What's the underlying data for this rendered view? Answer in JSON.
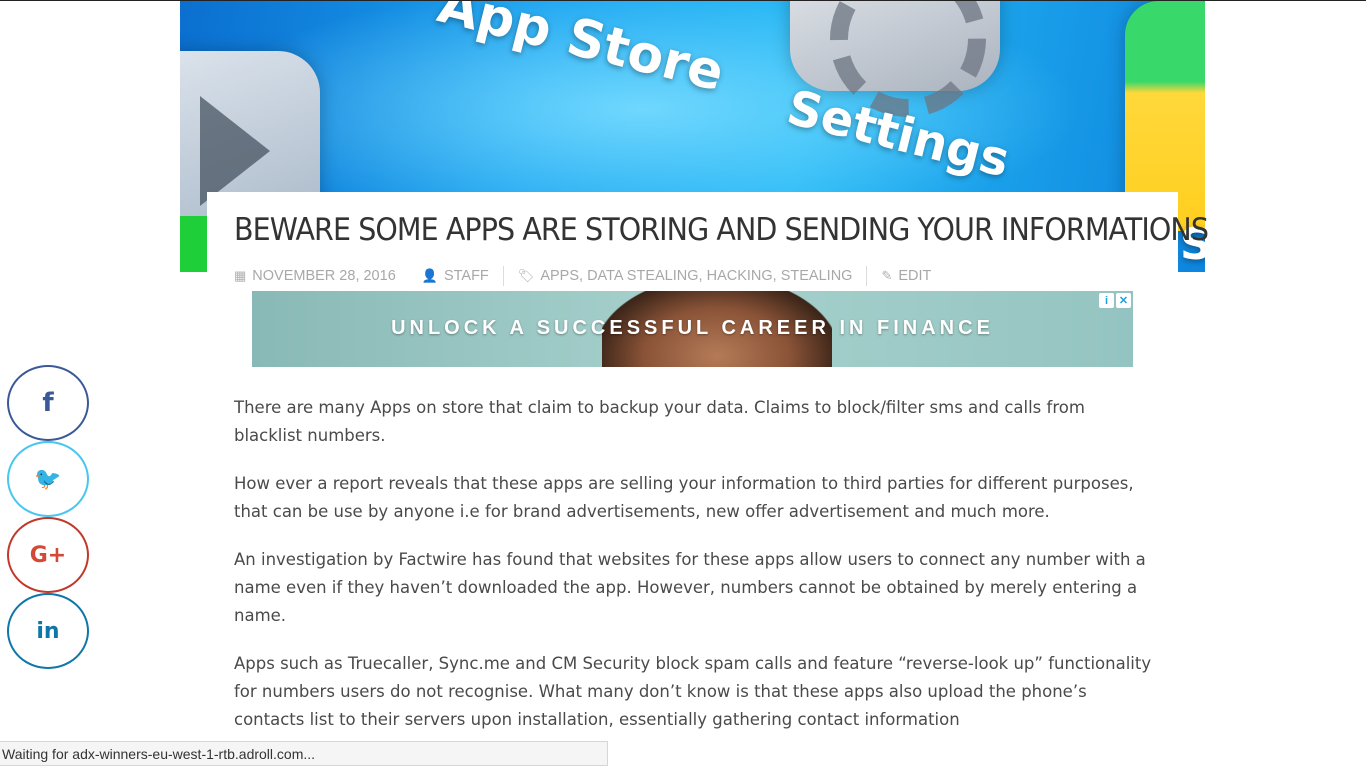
{
  "hero": {
    "app_store_label": "App Store",
    "settings_label": "Settings",
    "partial_label": "S"
  },
  "article": {
    "title": "BEWARE SOME APPS ARE STORING AND SENDING YOUR INFORMATIONS",
    "meta": {
      "date": "NOVEMBER 28, 2016",
      "author": "STAFF",
      "tags": [
        "APPS",
        "DATA STEALING",
        "HACKING",
        "STEALING"
      ],
      "edit_label": "EDIT"
    },
    "paragraphs": [
      "There are many Apps on store that claim to backup your data. Claims to block/filter sms and calls from blacklist numbers.",
      "How ever a report reveals that these apps are selling your information to third parties for different purposes, that can be use by anyone i.e for brand advertisements, new offer advertisement and much more.",
      "An investigation by Factwire has found that websites for these apps allow users to connect any number with a name even if they haven’t downloaded the app. However, numbers cannot be obtained by merely entering a name.",
      "Apps such as Truecaller, Sync.me and CM Security block spam calls and feature “reverse-look up” functionality for numbers users do not recognise. What many don’t know is that these apps also upload the phone’s contacts list to their servers upon installation, essentially gathering contact information"
    ]
  },
  "ad": {
    "text": "UNLOCK A SUCCESSFUL CAREER IN FINANCE",
    "info_label": "i",
    "close_label": "✕"
  },
  "share": {
    "facebook": "f",
    "twitter": "🐦",
    "google_plus": "G+",
    "linkedin": "in"
  },
  "status_bar": {
    "text": "Waiting for adx-winners-eu-west-1-rtb.adroll.com..."
  },
  "colors": {
    "title": "#333333",
    "meta": "#a8a8a8",
    "facebook": "#3b5998",
    "twitter": "#1da1f2",
    "google_plus": "#d34836",
    "linkedin": "#0e76a8"
  }
}
